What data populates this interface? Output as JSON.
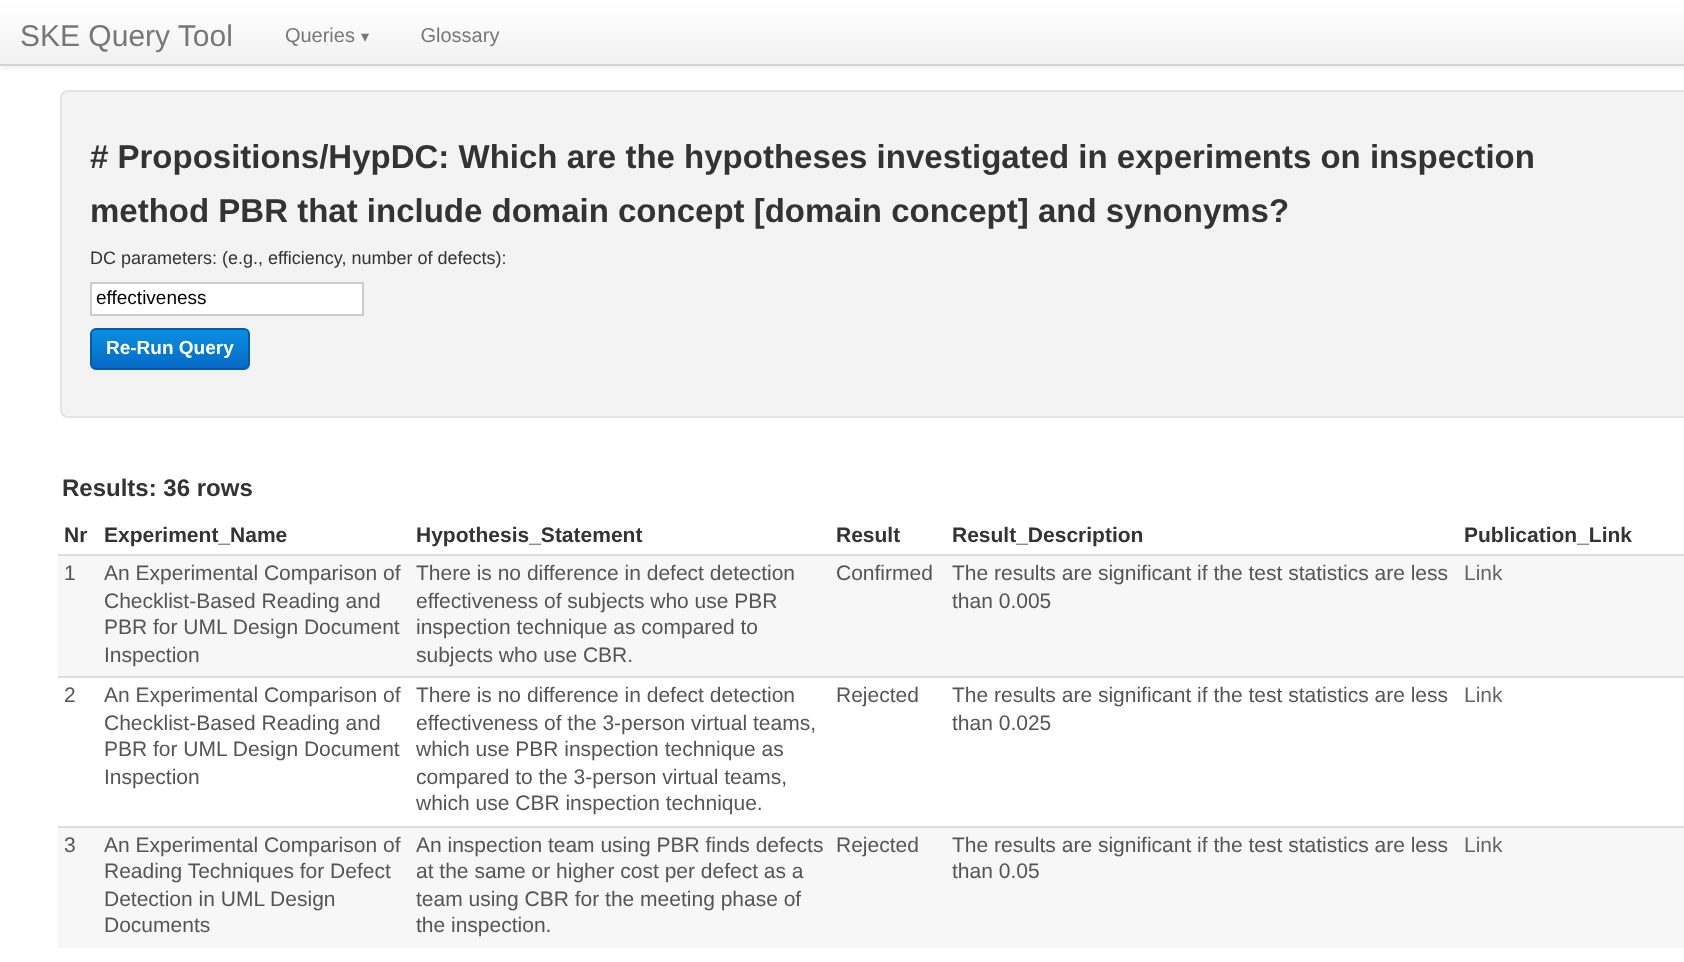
{
  "navbar": {
    "brand": "SKE Query Tool",
    "items": [
      {
        "label": "Queries",
        "kind": "dropdown",
        "caret": "▾"
      },
      {
        "label": "Glossary",
        "kind": "link"
      }
    ]
  },
  "query": {
    "title": "# Propositions/HypDC: Which are the hypotheses investigated in experiments on inspection method PBR that include domain concept [domain concept] and synonyms?",
    "field_label": "DC parameters: (e.g., efficiency, number of defects):",
    "field_value": "effectiveness",
    "button": "Re-Run Query"
  },
  "results": {
    "heading": "Results: 36 rows",
    "columns": [
      "Nr",
      "Experiment_Name",
      "Hypothesis_Statement",
      "Result",
      "Result_Description",
      "Publication_Link"
    ],
    "rows": [
      {
        "cells": [
          "1",
          "An Experimental Comparison of Checklist-Based Reading and PBR for UML Design Document Inspection",
          "There is no difference in defect detection effectiveness of subjects who use PBR inspection technique as compared to subjects who use CBR.",
          "Confirmed",
          "The results are significant if the test statistics are less than 0.005",
          "Link"
        ]
      },
      {
        "cells": [
          "2",
          "An Experimental Comparison of Checklist-Based Reading and PBR for UML Design Document Inspection",
          "There is no difference in defect detection effectiveness of the 3-person virtual teams, which use PBR inspection technique as compared to the 3-person virtual teams, which use CBR inspection technique.",
          "Rejected",
          "The results are significant if the test statistics are less than 0.025",
          "Link"
        ]
      },
      {
        "cells": [
          "3",
          "An Experimental Comparison of Reading Techniques for Defect Detection in UML Design Documents",
          "An inspection team using PBR finds defects at the same or higher cost per defect as a team using CBR for the meeting phase of the inspection.",
          "Rejected",
          "The results are significant if the test statistics are less than 0.05",
          "Link"
        ]
      }
    ]
  }
}
